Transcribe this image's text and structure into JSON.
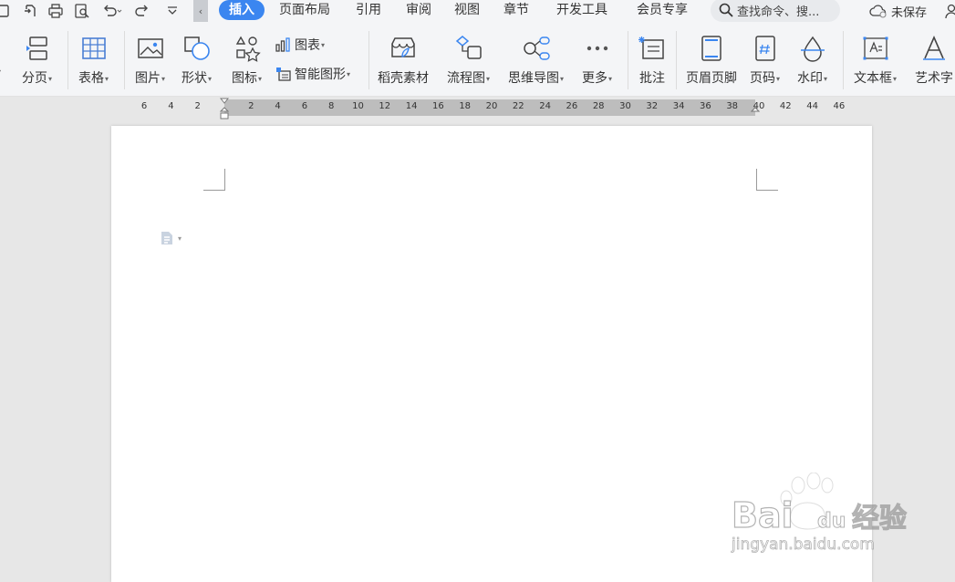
{
  "tabs": [
    {
      "label": "插入",
      "active": true
    },
    {
      "label": "页面布局"
    },
    {
      "label": "引用"
    },
    {
      "label": "审阅"
    },
    {
      "label": "视图"
    },
    {
      "label": "章节"
    },
    {
      "label": "开发工具"
    },
    {
      "label": "会员专享"
    }
  ],
  "search": {
    "placeholder": "查找命令、搜..."
  },
  "save_status": "未保存",
  "ribbon": {
    "items": [
      {
        "label": "分页",
        "icon": "page-break-icon",
        "dropdown": true
      },
      {
        "label": "表格",
        "icon": "table-icon",
        "dropdown": true
      },
      {
        "label": "图片",
        "icon": "picture-icon",
        "dropdown": true
      },
      {
        "label": "形状",
        "icon": "shape-icon",
        "dropdown": true
      },
      {
        "label": "图标",
        "icon": "icon-library-icon",
        "dropdown": true
      },
      {
        "label": "图表",
        "icon": "chart-icon",
        "dropdown": true
      },
      {
        "label": "智能图形",
        "icon": "smart-art-icon",
        "dropdown": true
      },
      {
        "label": "稻壳素材",
        "icon": "docer-material-icon",
        "dropdown": false
      },
      {
        "label": "流程图",
        "icon": "flowchart-icon",
        "dropdown": true
      },
      {
        "label": "思维导图",
        "icon": "mindmap-icon",
        "dropdown": true
      },
      {
        "label": "更多",
        "icon": "more-icon",
        "dropdown": true
      },
      {
        "label": "批注",
        "icon": "comment-icon",
        "dropdown": false
      },
      {
        "label": "页眉页脚",
        "icon": "header-footer-icon",
        "dropdown": false
      },
      {
        "label": "页码",
        "icon": "page-number-icon",
        "dropdown": true
      },
      {
        "label": "水印",
        "icon": "watermark-icon",
        "dropdown": true
      },
      {
        "label": "文本框",
        "icon": "text-box-icon",
        "dropdown": true
      },
      {
        "label": "艺术字",
        "icon": "word-art-icon",
        "dropdown": false
      }
    ]
  },
  "ruler": {
    "ticks": [
      "6",
      "4",
      "2",
      "2",
      "4",
      "6",
      "8",
      "10",
      "12",
      "14",
      "16",
      "18",
      "20",
      "22",
      "24",
      "26",
      "28",
      "30",
      "32",
      "34",
      "36",
      "38",
      "40",
      "42",
      "44",
      "46"
    ]
  },
  "watermark": {
    "brand": "Baidu经验",
    "url": "jingyan.baidu.com"
  },
  "colors": {
    "accent": "#3b86f0",
    "icon_blue": "#4a7fd4",
    "background": "#e7e7e7",
    "toolbar": "#f4f5f7"
  }
}
